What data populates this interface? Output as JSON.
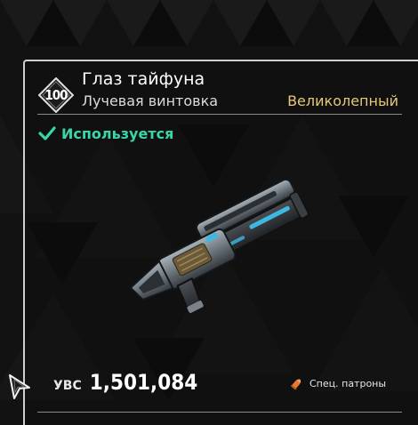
{
  "item": {
    "level": "100",
    "name": "Глаз тайфуна",
    "type": "Лучевая винтовка",
    "rarity": "Великолепный",
    "status": "Используется"
  },
  "price": {
    "currency_label": "УВС",
    "value": "1,501,084"
  },
  "ammo": {
    "label": "Спец. патроны",
    "icon": "bullet-icon"
  },
  "colors": {
    "rarity": "#e8c877",
    "equipped": "#38d6a8",
    "ammo_icon": "#e8782c",
    "background": "#101010"
  },
  "icons": {
    "status": "checkmark-icon",
    "level": "level-diamond-icon",
    "weapon": "beam-rifle-icon",
    "cursor": "mouse-cursor-icon"
  }
}
